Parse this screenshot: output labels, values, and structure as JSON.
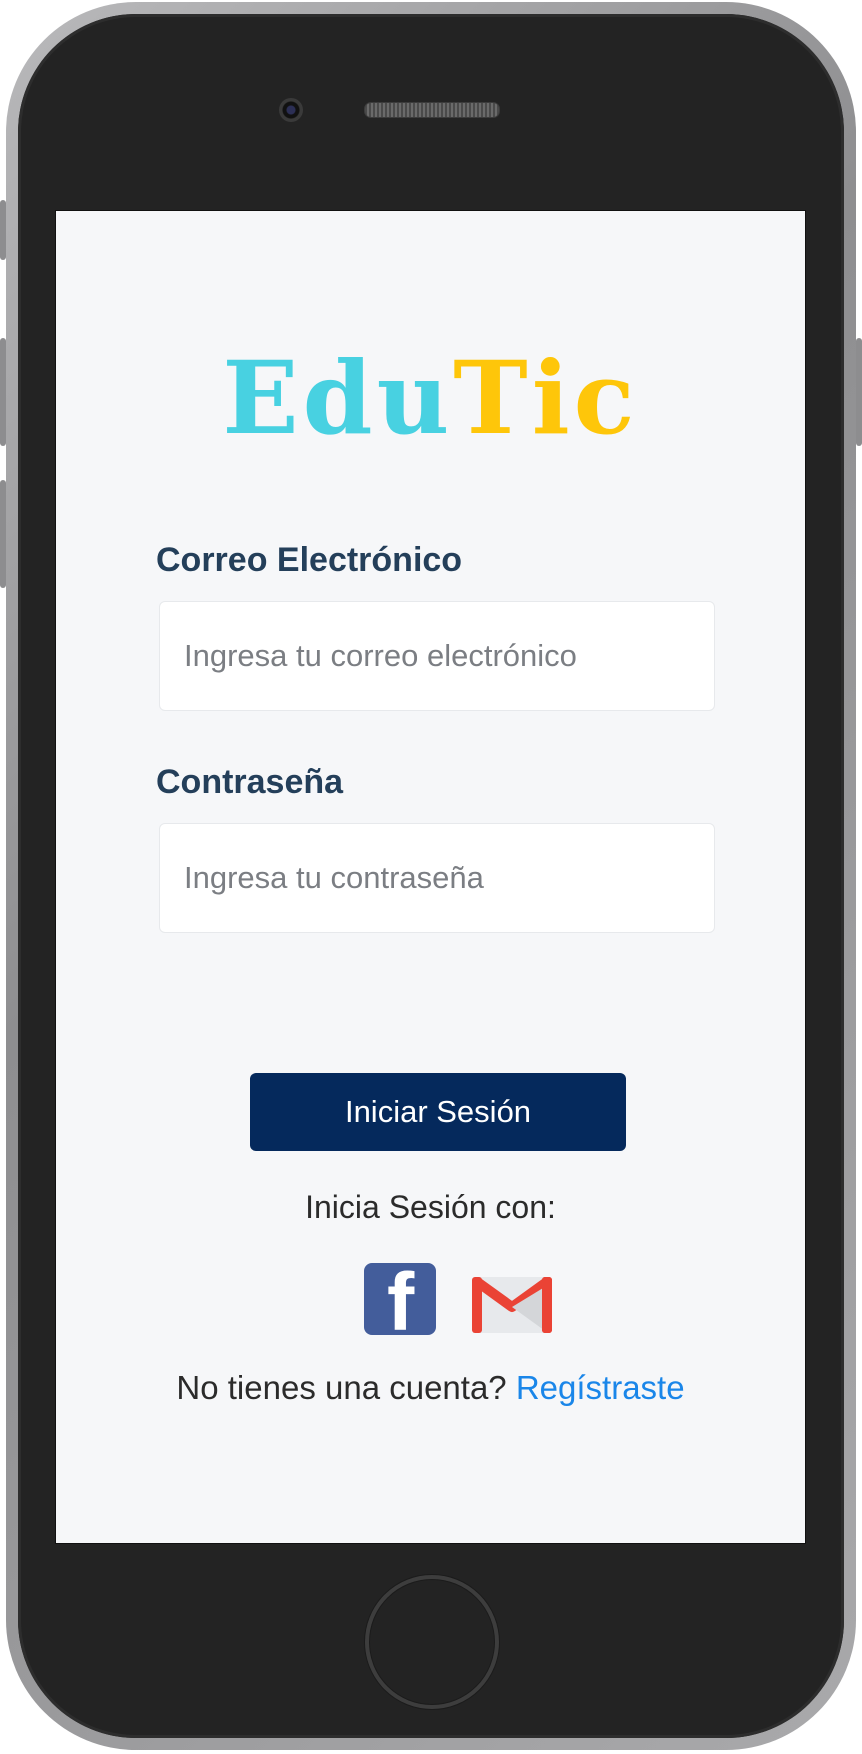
{
  "app": {
    "logo": {
      "part1": "Edu",
      "part2": "Tic",
      "color1": "#48d1e1",
      "color2": "#fec60a"
    }
  },
  "form": {
    "email_label": "Correo Electrónico",
    "email_placeholder": "Ingresa tu correo electrónico",
    "email_value": "",
    "password_label": "Contraseña",
    "password_placeholder": "Ingresa tu contraseña",
    "password_value": "",
    "submit_label": "Iniciar Sesión"
  },
  "social": {
    "prompt": "Inicia Sesión con:",
    "providers": [
      {
        "icon": "facebook-icon",
        "color": "#435d9b"
      },
      {
        "icon": "gmail-icon",
        "color": "#ea4335"
      }
    ]
  },
  "register": {
    "question": "No tienes una cuenta?",
    "link": "Regístraste",
    "link_color": "#1a86e9"
  }
}
